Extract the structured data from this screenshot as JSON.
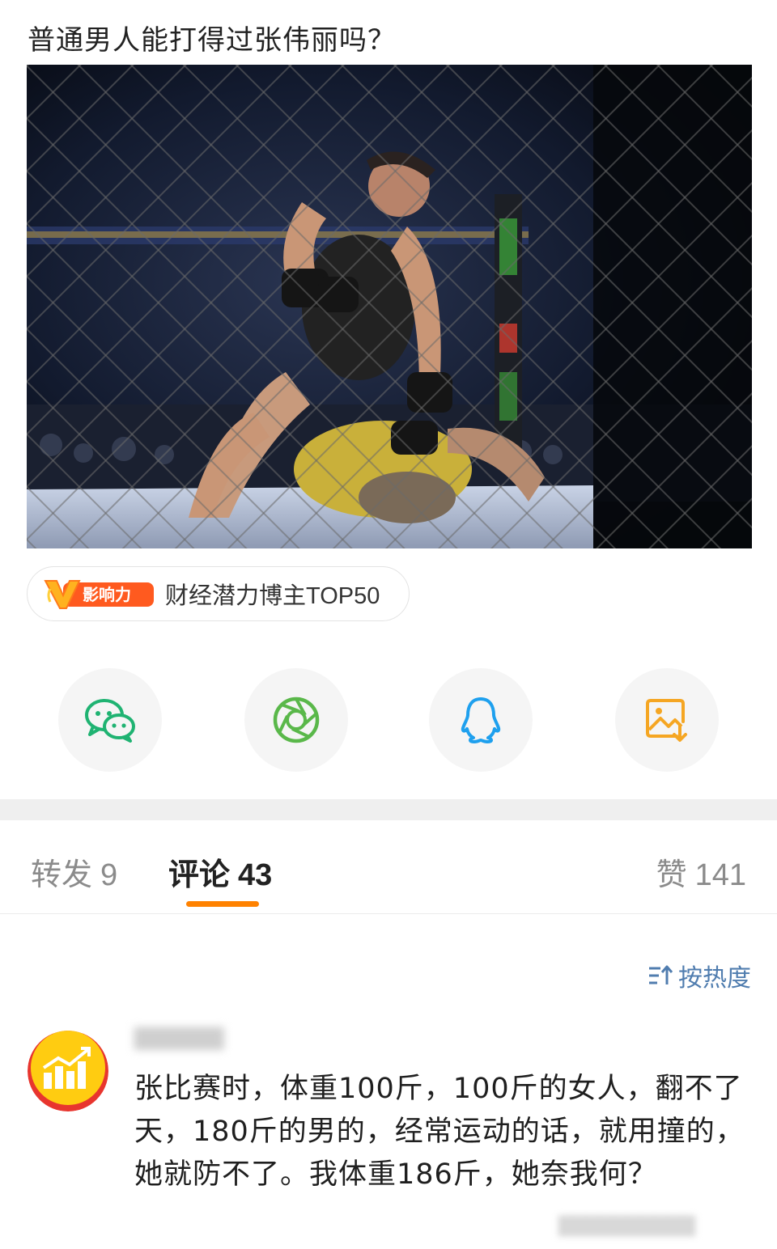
{
  "post": {
    "title": "普通男人能打得过张伟丽吗？"
  },
  "badge": {
    "logo_text": "影响力",
    "label": "财经潜力博主TOP50"
  },
  "share_buttons": [
    {
      "name": "wechat",
      "icon": "wechat-icon",
      "color": "#1fb372"
    },
    {
      "name": "moments",
      "icon": "camera-aperture-icon",
      "color": "#5ab84a"
    },
    {
      "name": "qq",
      "icon": "qq-penguin-icon",
      "color": "#1ea0ee"
    },
    {
      "name": "save-image",
      "icon": "image-download-icon",
      "color": "#f5a623"
    }
  ],
  "tabs": {
    "repost": {
      "label": "转发",
      "count": "9"
    },
    "comments": {
      "label": "评论",
      "count": "43"
    },
    "likes": {
      "label": "赞",
      "count": "141"
    }
  },
  "sort": {
    "label": "按热度"
  },
  "comment": {
    "text": "张比赛时，体重100斤，100斤的女人，翻不了天，180斤的男的，经常运动的话，就用撞的，她就防不了。我体重186斤，她奈我何？"
  },
  "colors": {
    "accent": "#ff8200",
    "link": "#507daf"
  }
}
